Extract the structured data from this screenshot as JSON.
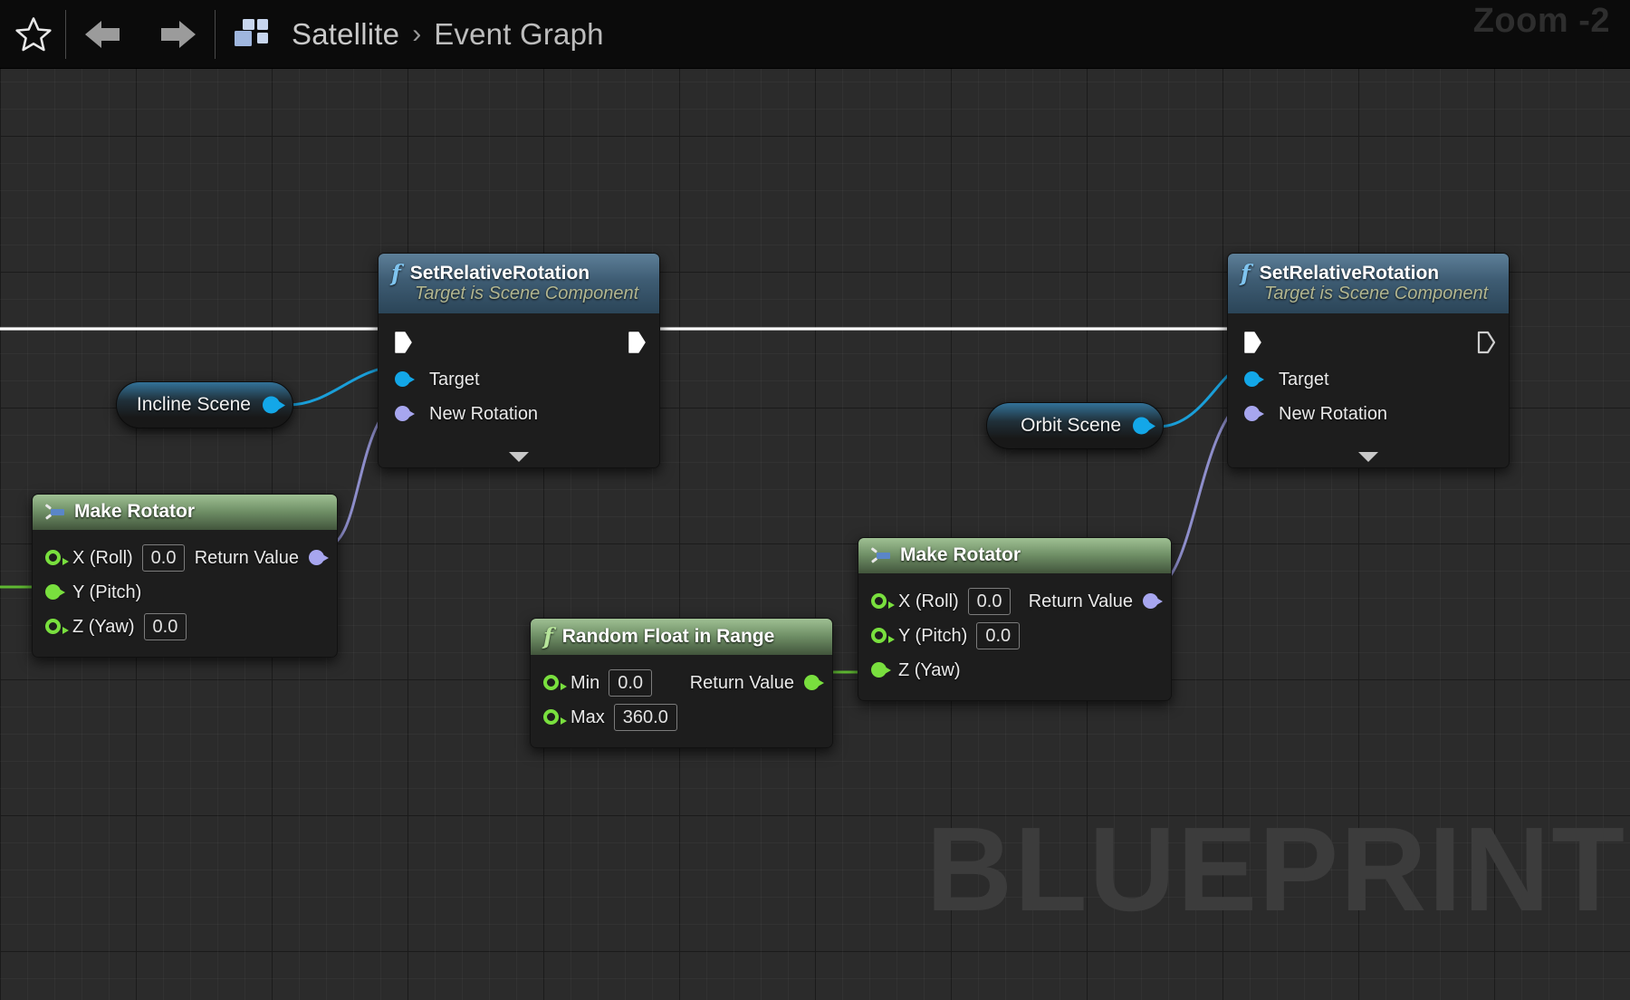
{
  "window": {
    "title": "Blueprint Event Graph",
    "zoom_label": "Zoom -2",
    "watermark": "BLUEPRINT"
  },
  "toolbar": {
    "star_icon": "star-icon",
    "back_icon": "arrow-left-icon",
    "forward_icon": "arrow-right-icon",
    "blueprint_icon": "blueprint-grid-icon",
    "breadcrumb": {
      "root": "Satellite",
      "separator": "›",
      "current": "Event Graph"
    }
  },
  "colors": {
    "exec_white": "#ffffff",
    "object_cyan": "#13a7e8",
    "float_green": "#79df3e",
    "rotator_purple": "#a7a6ef",
    "fn_header": "#3e5c73",
    "pure_header": "#6f8f66",
    "canvas": "#2b2b2b",
    "watermark": "#3c3c3c"
  },
  "graph": {
    "nodes": [
      {
        "id": "set_relative_rotation_1",
        "type": "function",
        "title": "SetRelativeRotation",
        "subtitle": "Target is Scene Component",
        "icon": "function-f-icon",
        "inputs": [
          {
            "label": "Target",
            "pin": "object",
            "connected": true
          },
          {
            "label": "New Rotation",
            "pin": "rotator",
            "connected": true
          }
        ],
        "exec_in": true,
        "exec_out": true,
        "exec_out_connected": true,
        "expander": true
      },
      {
        "id": "set_relative_rotation_2",
        "type": "function",
        "title": "SetRelativeRotation",
        "subtitle": "Target is Scene Component",
        "icon": "function-f-icon",
        "inputs": [
          {
            "label": "Target",
            "pin": "object",
            "connected": true
          },
          {
            "label": "New Rotation",
            "pin": "rotator",
            "connected": true
          }
        ],
        "exec_in": true,
        "exec_out": true,
        "exec_out_connected": false,
        "expander": true
      },
      {
        "id": "make_rotator_1",
        "type": "pure",
        "title": "Make Rotator",
        "icon": "make-struct-icon",
        "inputs": [
          {
            "label": "X (Roll)",
            "pin": "float",
            "connected": false,
            "value": "0.0"
          },
          {
            "label": "Y (Pitch)",
            "pin": "float",
            "connected": true
          },
          {
            "label": "Z (Yaw)",
            "pin": "float",
            "connected": false,
            "value": "0.0"
          }
        ],
        "outputs": [
          {
            "label": "Return Value",
            "pin": "rotator",
            "connected": true
          }
        ]
      },
      {
        "id": "make_rotator_2",
        "type": "pure",
        "title": "Make Rotator",
        "icon": "make-struct-icon",
        "inputs": [
          {
            "label": "X (Roll)",
            "pin": "float",
            "connected": false,
            "value": "0.0"
          },
          {
            "label": "Y (Pitch)",
            "pin": "float",
            "connected": false,
            "value": "0.0"
          },
          {
            "label": "Z (Yaw)",
            "pin": "float",
            "connected": true
          }
        ],
        "outputs": [
          {
            "label": "Return Value",
            "pin": "rotator",
            "connected": true
          }
        ]
      },
      {
        "id": "random_float_in_range",
        "type": "pure",
        "title": "Random Float in Range",
        "icon": "function-f-icon",
        "inputs": [
          {
            "label": "Min",
            "pin": "float",
            "connected": false,
            "value": "0.0"
          },
          {
            "label": "Max",
            "pin": "float",
            "connected": false,
            "value": "360.0"
          }
        ],
        "outputs": [
          {
            "label": "Return Value",
            "pin": "float",
            "connected": true
          }
        ]
      },
      {
        "id": "incline_scene_getter",
        "type": "variable",
        "title": "Incline Scene",
        "outputs": [
          {
            "pin": "object",
            "connected": true
          }
        ]
      },
      {
        "id": "orbit_scene_getter",
        "type": "variable",
        "title": "Orbit Scene",
        "outputs": [
          {
            "pin": "object",
            "connected": true
          }
        ]
      }
    ]
  },
  "labels": {
    "srr1_title": "SetRelativeRotation",
    "srr1_sub": "Target is Scene Component",
    "srr1_target": "Target",
    "srr1_newrot": "New Rotation",
    "srr2_title": "SetRelativeRotation",
    "srr2_sub": "Target is Scene Component",
    "srr2_target": "Target",
    "srr2_newrot": "New Rotation",
    "mr1_title": "Make Rotator",
    "mr1_roll": "X (Roll)",
    "mr1_roll_val": "0.0",
    "mr1_pitch": "Y (Pitch)",
    "mr1_yaw": "Z (Yaw)",
    "mr1_yaw_val": "0.0",
    "mr1_ret": "Return Value",
    "mr2_title": "Make Rotator",
    "mr2_roll": "X (Roll)",
    "mr2_roll_val": "0.0",
    "mr2_pitch": "Y (Pitch)",
    "mr2_pitch_val": "0.0",
    "mr2_yaw": "Z (Yaw)",
    "mr2_ret": "Return Value",
    "rf_title": "Random Float in Range",
    "rf_min": "Min",
    "rf_min_val": "0.0",
    "rf_max": "Max",
    "rf_max_val": "360.0",
    "rf_ret": "Return Value",
    "incline_var": "Incline Scene",
    "orbit_var": "Orbit Scene",
    "fn_glyph": "f"
  }
}
